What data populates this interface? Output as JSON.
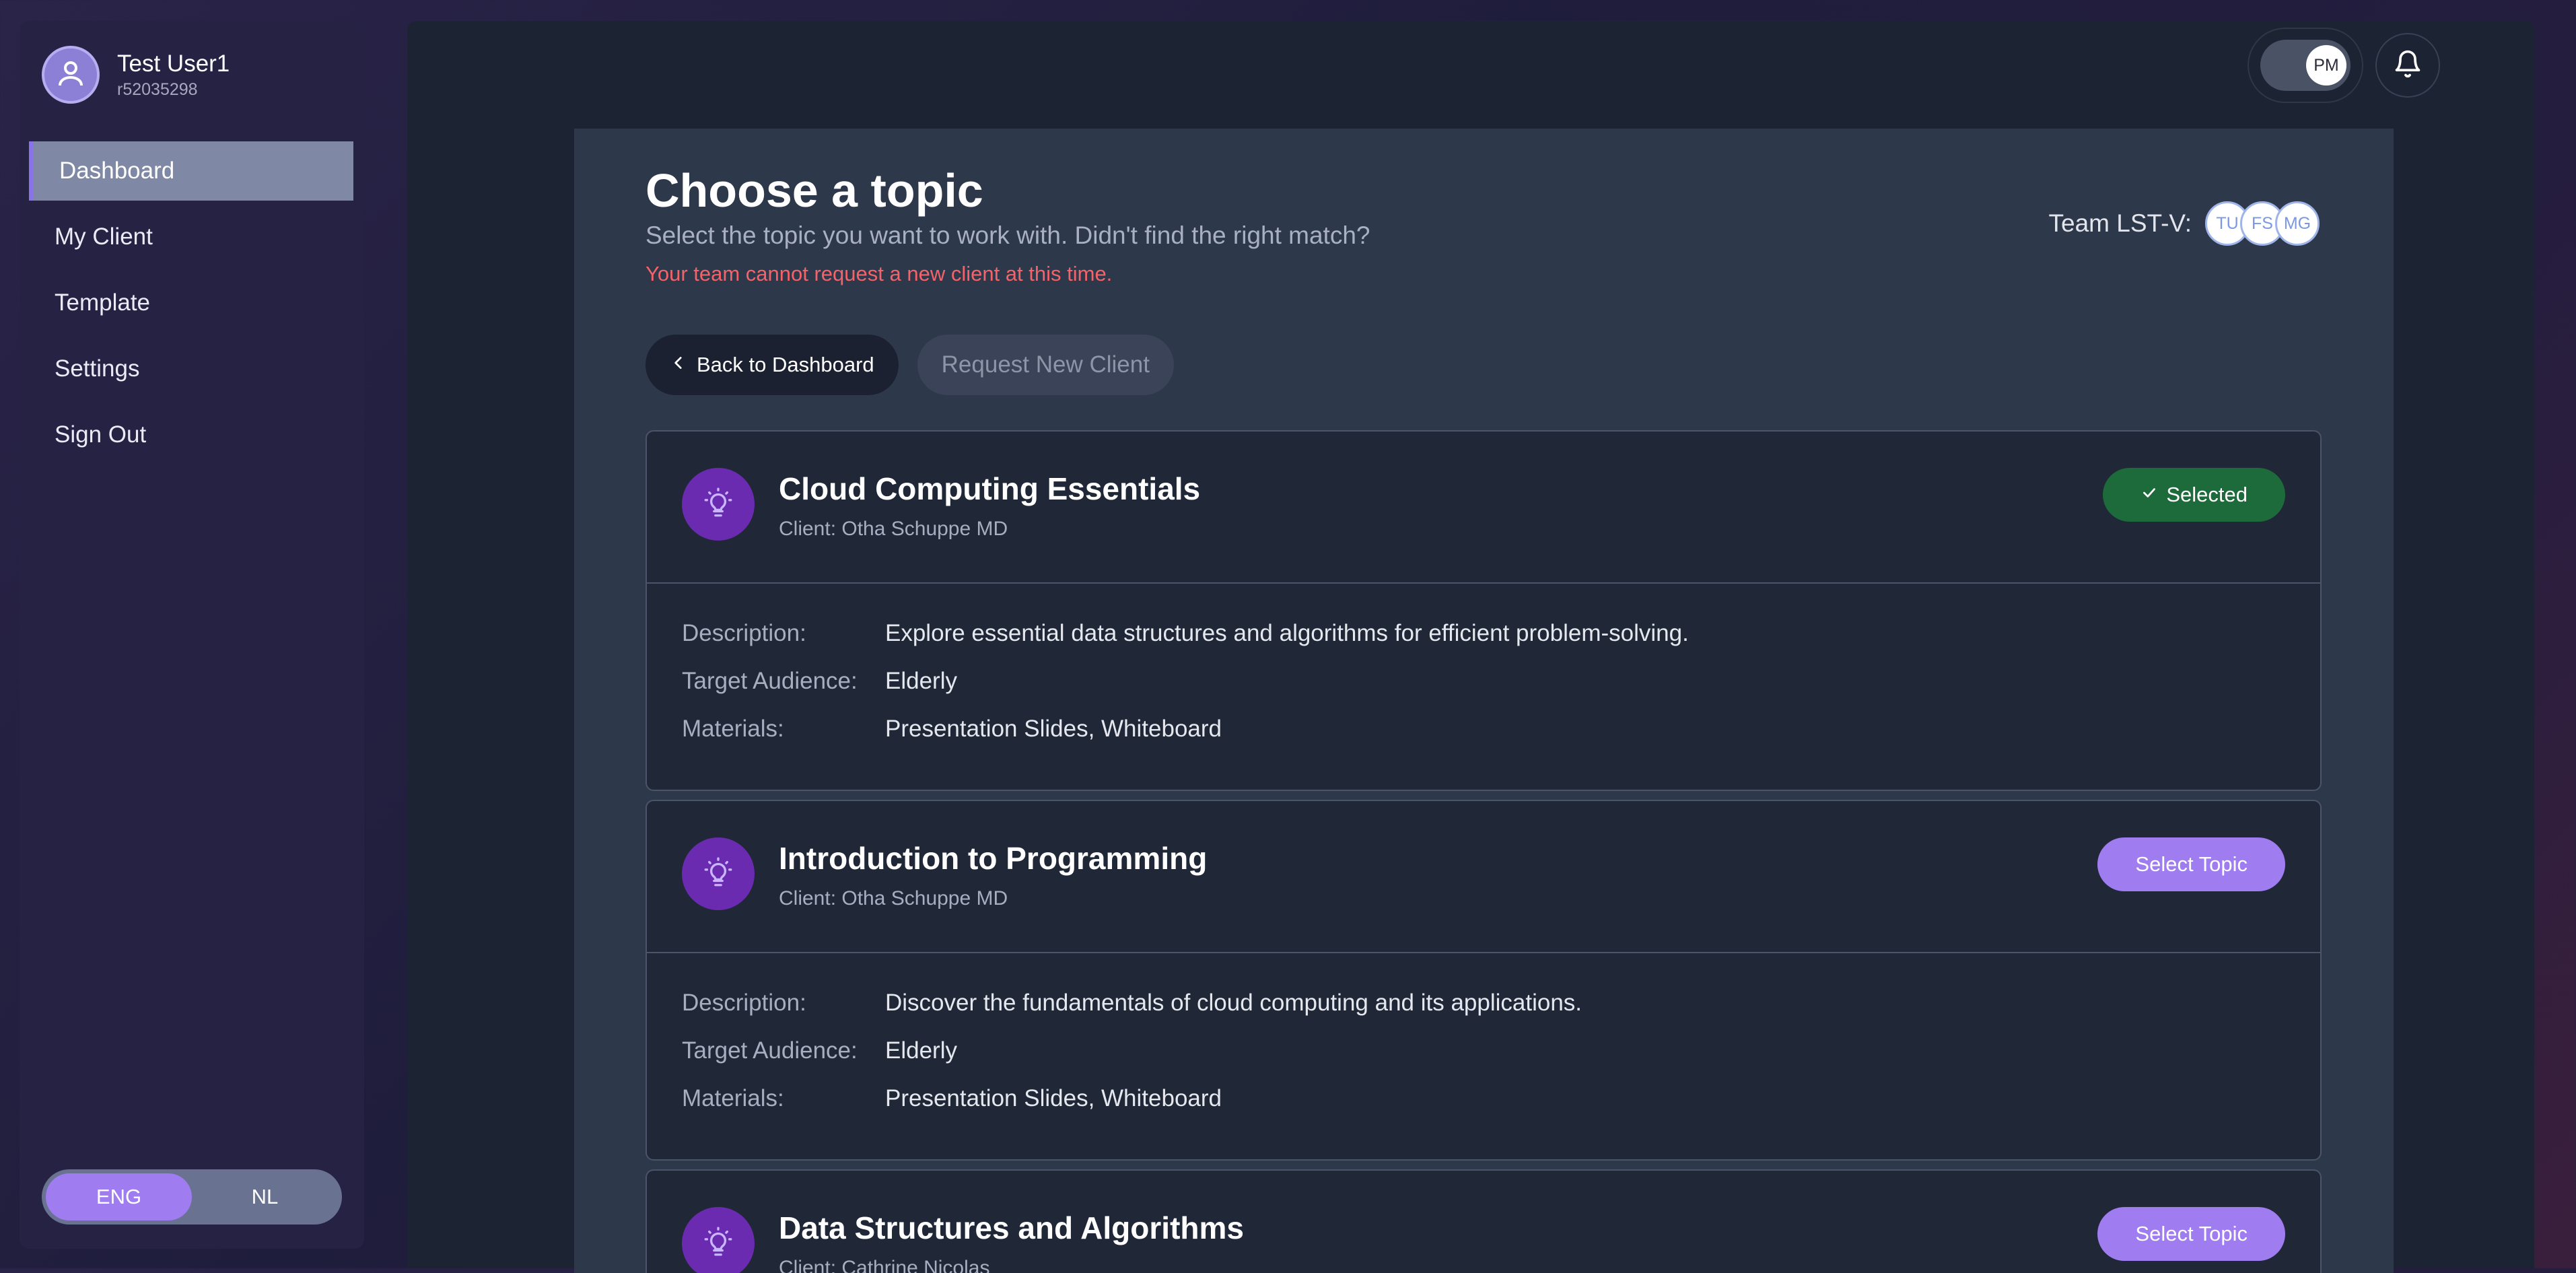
{
  "user": {
    "name": "Test User1",
    "id": "r52035298"
  },
  "sidebar": {
    "items": [
      {
        "label": "Dashboard"
      },
      {
        "label": "My Client"
      },
      {
        "label": "Template"
      },
      {
        "label": "Settings"
      },
      {
        "label": "Sign Out"
      }
    ],
    "active": "Dashboard"
  },
  "language": {
    "options": [
      "ENG",
      "NL"
    ],
    "active": "ENG"
  },
  "header": {
    "toggle_label": "PM"
  },
  "page": {
    "title": "Choose a topic",
    "subtitle": "Select the topic you want to work with. Didn't find the right match?",
    "warning": "Your team cannot request a new client at this time.",
    "back_button": "Back to Dashboard",
    "request_button": "Request New Client",
    "team_label": "Team LST-V:",
    "team_members": [
      "TU",
      "FS",
      "MG"
    ]
  },
  "labels": {
    "description": "Description:",
    "target_audience": "Target Audience:",
    "materials": "Materials:",
    "selected": "Selected",
    "select_topic": "Select Topic"
  },
  "topics": [
    {
      "title": "Cloud Computing Essentials",
      "client": "Client: Otha Schuppe MD",
      "description": "Explore essential data structures and algorithms for efficient problem-solving.",
      "target_audience": "Elderly",
      "materials": "Presentation Slides, Whiteboard",
      "selected": true
    },
    {
      "title": "Introduction to Programming",
      "client": "Client: Otha Schuppe MD",
      "description": "Discover the fundamentals of cloud computing and its applications.",
      "target_audience": "Elderly",
      "materials": "Presentation Slides, Whiteboard",
      "selected": false
    },
    {
      "title": "Data Structures and Algorithms",
      "client": "Client: Cathrine Nicolas",
      "description": "",
      "target_audience": "",
      "materials": "",
      "selected": false
    }
  ],
  "colors": {
    "accent": "#9f7cf0",
    "selected_badge": "#1d6a3a",
    "warning": "#f2646a",
    "icon_bg": "#6a2bb0"
  },
  "icons": {
    "avatar": "user-icon",
    "notification": "bell-icon",
    "topic": "lightbulb-icon",
    "back": "chevron-left-icon",
    "check": "check-icon"
  }
}
